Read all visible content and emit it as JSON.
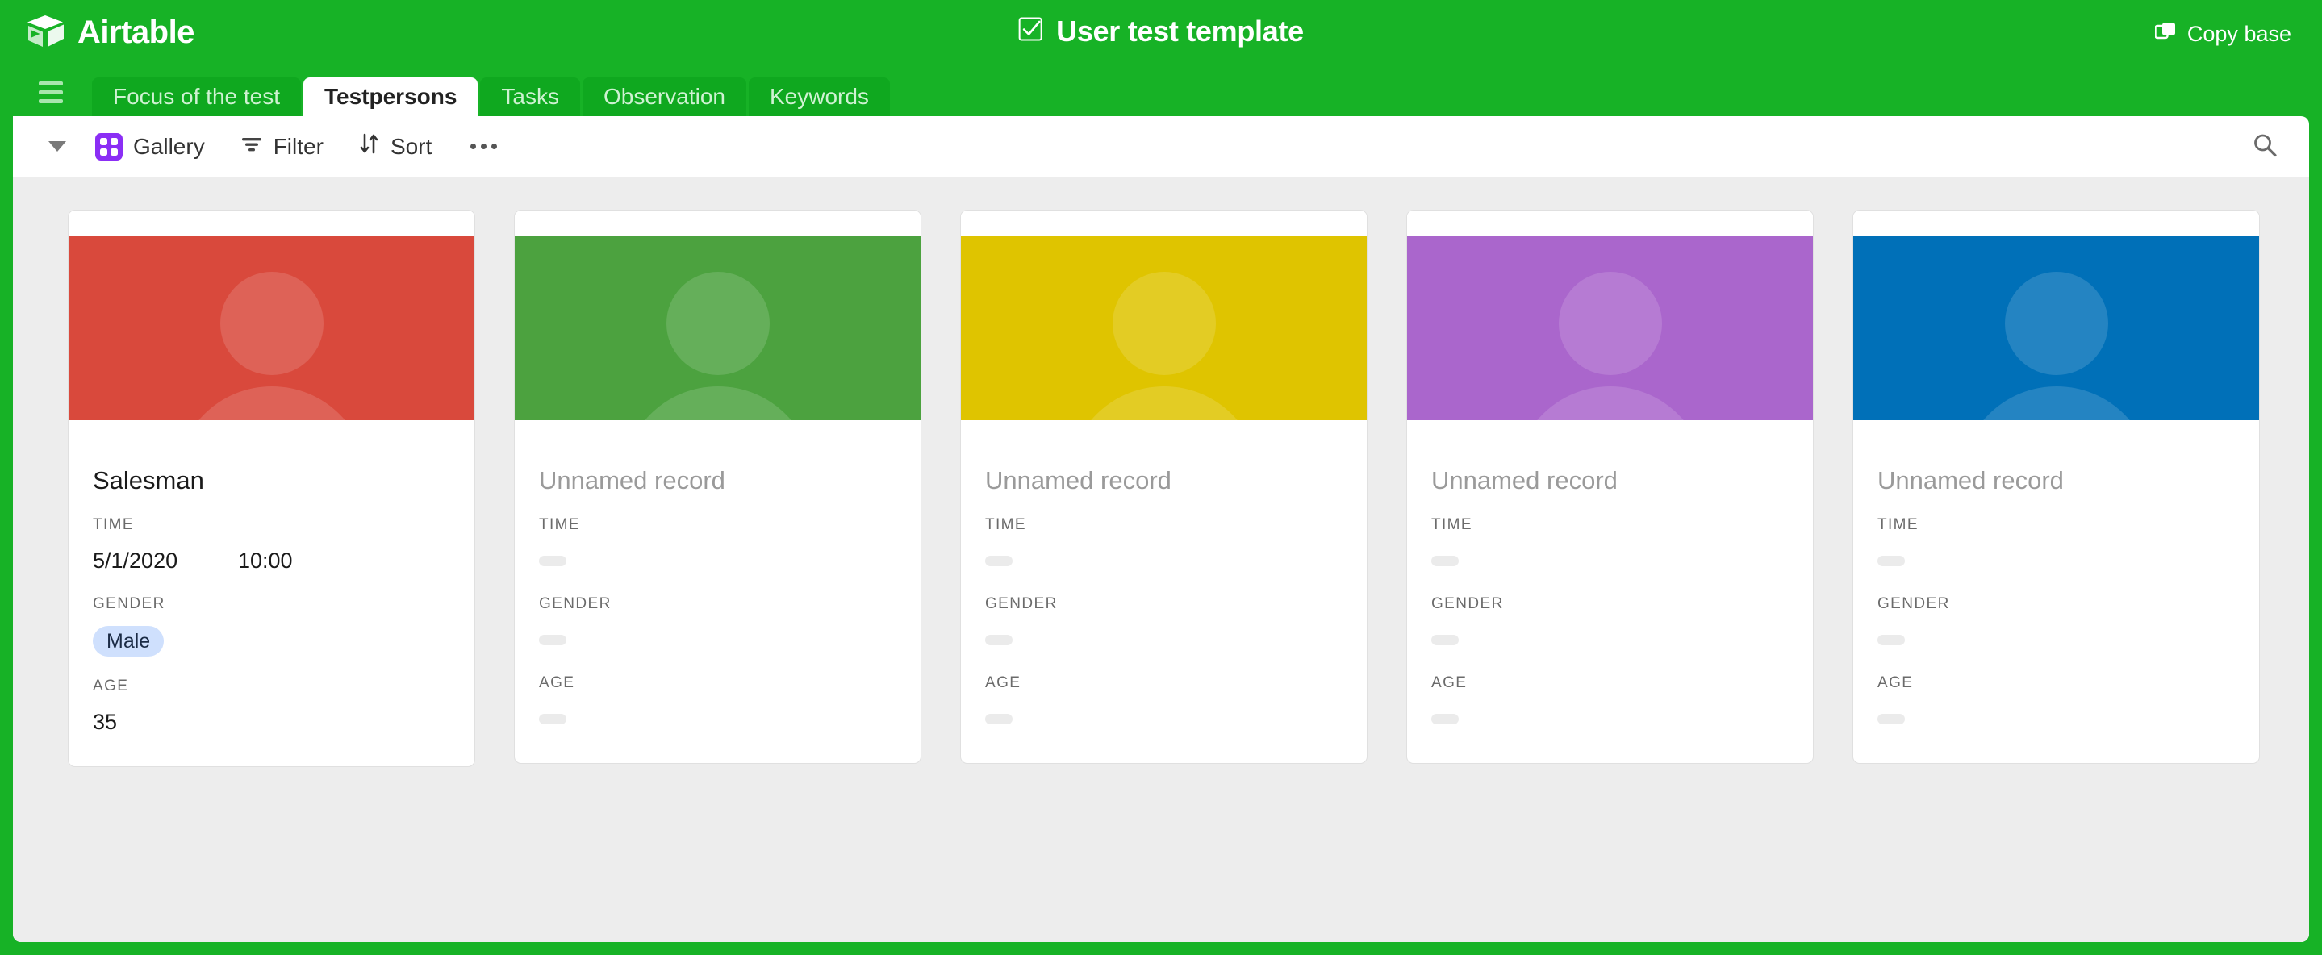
{
  "header": {
    "brand_name": "Airtable",
    "brand_logo_icon": "airtable-cube-logo",
    "base_title": "User test template",
    "base_title_icon": "checkbox-checked-icon",
    "copy_base_label": "Copy base",
    "copy_base_icon": "copy-duplicate-icon",
    "bg_color": "#17B226"
  },
  "tabs": {
    "menu_icon": "hamburger-menu-icon",
    "items": [
      {
        "label": "Focus of the test",
        "active": false
      },
      {
        "label": "Testpersons",
        "active": true
      },
      {
        "label": "Tasks",
        "active": false
      },
      {
        "label": "Observation",
        "active": false
      },
      {
        "label": "Keywords",
        "active": false
      }
    ]
  },
  "toolbar": {
    "collapse_icon": "chevron-down-icon",
    "view_icon": "gallery-grid-icon",
    "view_label": "Gallery",
    "filter_icon": "filter-icon",
    "filter_label": "Filter",
    "sort_icon": "sort-arrows-icon",
    "sort_label": "Sort",
    "more_icon": "more-horizontal-icon",
    "search_icon": "search-icon",
    "accent_color": "#8B2EF5"
  },
  "gallery": {
    "field_labels": {
      "time": "TIME",
      "gender": "GENDER",
      "age": "AGE"
    },
    "empty_title": "Unnamed record",
    "cards": [
      {
        "title": "Salesman",
        "empty": false,
        "image_color": "#D9493C",
        "avatar_icon": "person-avatar-icon",
        "date": "5/1/2020",
        "time": "10:00",
        "gender": "Male",
        "gender_pill_bg": "#CFE0FD",
        "age": "35"
      },
      {
        "title": "Unnamed record",
        "empty": true,
        "image_color": "#4CA23F",
        "avatar_icon": "person-avatar-icon",
        "date": "",
        "time": "",
        "gender": "",
        "age": ""
      },
      {
        "title": "Unnamed record",
        "empty": true,
        "image_color": "#DFC400",
        "avatar_icon": "person-avatar-icon",
        "date": "",
        "time": "",
        "gender": "",
        "age": ""
      },
      {
        "title": "Unnamed record",
        "empty": true,
        "image_color": "#AA66CC",
        "avatar_icon": "person-avatar-icon",
        "date": "",
        "time": "",
        "gender": "",
        "age": ""
      },
      {
        "title": "Unnamed record",
        "empty": true,
        "image_color": "#0070B8",
        "avatar_icon": "person-avatar-icon",
        "date": "",
        "time": "",
        "gender": "",
        "age": ""
      }
    ]
  }
}
